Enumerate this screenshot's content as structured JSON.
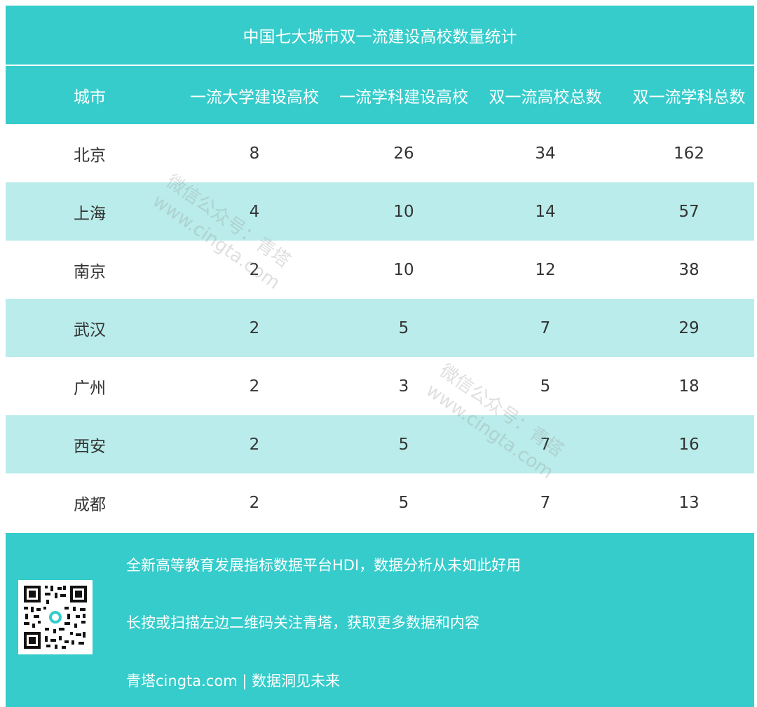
{
  "title": "中国七大城市双一流建设高校数量统计",
  "table": {
    "headers": [
      "城市",
      "一流大学建设高校",
      "一流学科建设高校",
      "双一流高校总数",
      "双一流学科总数"
    ],
    "rows": [
      {
        "city": "北京",
        "first_class_univ": "8",
        "first_class_discipline_univ": "26",
        "total_univ": "34",
        "total_disciplines": "162"
      },
      {
        "city": "上海",
        "first_class_univ": "4",
        "first_class_discipline_univ": "10",
        "total_univ": "14",
        "total_disciplines": "57"
      },
      {
        "city": "南京",
        "first_class_univ": "2",
        "first_class_discipline_univ": "10",
        "total_univ": "12",
        "total_disciplines": "38"
      },
      {
        "city": "武汉",
        "first_class_univ": "2",
        "first_class_discipline_univ": "5",
        "total_univ": "7",
        "total_disciplines": "29"
      },
      {
        "city": "广州",
        "first_class_univ": "2",
        "first_class_discipline_univ": "3",
        "total_univ": "5",
        "total_disciplines": "18"
      },
      {
        "city": "西安",
        "first_class_univ": "2",
        "first_class_discipline_univ": "5",
        "total_univ": "7",
        "total_disciplines": "16"
      },
      {
        "city": "成都",
        "first_class_univ": "2",
        "first_class_discipline_univ": "5",
        "total_univ": "7",
        "total_disciplines": "13"
      }
    ]
  },
  "footer": {
    "line1": "全新高等教育发展指标数据平台HDI，数据分析从未如此好用",
    "line2": "长按或扫描左边二维码关注青塔，获取更多数据和内容",
    "line3": "青塔cingta.com | 数据洞见未来"
  },
  "watermark": {
    "line1": "微信公众号：青塔",
    "line2": "www.cingta.com"
  },
  "colors": {
    "teal": "#35cccb",
    "light_teal": "#b9ecea",
    "text_dark": "#333333",
    "text_light": "#ffffff"
  }
}
